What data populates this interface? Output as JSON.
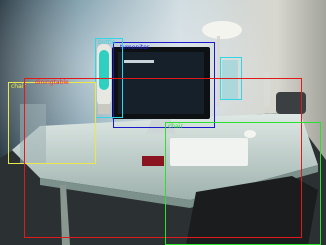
{
  "image": {
    "description_free": true,
    "detections": [
      {
        "id": "tvmonitor",
        "label": "tvmonitor",
        "color": "#1a1acc"
      },
      {
        "id": "bottle-lamp",
        "label": "bottle",
        "color": "#33d6e6"
      },
      {
        "id": "bottle-glass",
        "label": "",
        "color": "#33d6e6"
      },
      {
        "id": "chair",
        "label": "chair",
        "color": "#e8e84a"
      },
      {
        "id": "diningtable",
        "label": "diningtable",
        "color": "#e01a1a"
      },
      {
        "id": "chair-front",
        "label": "chair",
        "color": "#2ee02e"
      }
    ]
  }
}
